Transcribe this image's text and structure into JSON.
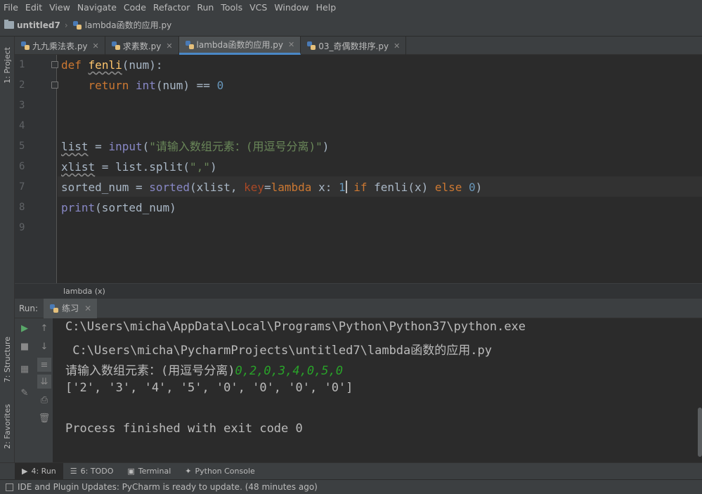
{
  "menu": [
    "File",
    "Edit",
    "View",
    "Navigate",
    "Code",
    "Refactor",
    "Run",
    "Tools",
    "VCS",
    "Window",
    "Help"
  ],
  "breadcrumb": {
    "project": "untitled7",
    "file": "lambda函数的应用.py"
  },
  "left_tools": {
    "project": "1: Project",
    "structure": "7: Structure",
    "favorites": "2: Favorites"
  },
  "tabs": [
    {
      "label": "九九乘法表.py",
      "active": false
    },
    {
      "label": "求素数.py",
      "active": false
    },
    {
      "label": "lambda函数的应用.py",
      "active": true
    },
    {
      "label": "03_奇偶数排序.py",
      "active": false
    }
  ],
  "line_numbers": [
    "1",
    "2",
    "3",
    "4",
    "5",
    "6",
    "7",
    "8",
    "9"
  ],
  "code": {
    "l1": {
      "def": "def",
      "name": "fenli",
      "rest": "(num):"
    },
    "l2": {
      "ret": "return",
      "int": "int",
      "rest": "(num) == ",
      "num": "0"
    },
    "l5": {
      "var": "list",
      "eq": " = ",
      "input": "input",
      "open": "(",
      "str": "\"请输入数组元素：(用逗号分离)\"",
      "close": ")"
    },
    "l6": {
      "var": "xlist",
      "rest1": " = list.split(",
      "str": "\",\"",
      "rest2": ")"
    },
    "l7": {
      "a": "sorted_num = ",
      "sorted": "sorted",
      "b": "(xlist, ",
      "key": "key",
      "c": "=",
      "lambda": "lambda",
      "d": " x: ",
      "one": "1",
      "if": "if",
      "e": " fenli(x) ",
      "else": "else",
      "zero": "0",
      "f": ")"
    },
    "l8": {
      "print": "print",
      "rest": "(sorted_num)"
    }
  },
  "hint": "lambda (x)",
  "run": {
    "label": "Run:",
    "config": "练习",
    "output": [
      "C:\\Users\\micha\\AppData\\Local\\Programs\\Python\\Python37\\python.exe",
      " C:\\Users\\micha\\PycharmProjects\\untitled7\\lambda函数的应用.py",
      "请输入数组元素：(用逗号分离)",
      "['2', '3', '4', '5', '0', '0', '0', '0']",
      "",
      "Process finished with exit code 0"
    ],
    "user_input": "0,2,0,3,4,0,5,0"
  },
  "bottom_tabs": [
    {
      "icon": "▶",
      "label": "4: Run"
    },
    {
      "icon": "☰",
      "label": "6: TODO"
    },
    {
      "icon": "▣",
      "label": "Terminal"
    },
    {
      "icon": "✦",
      "label": "Python Console"
    }
  ],
  "status": "IDE and Plugin Updates: PyCharm is ready to update. (48 minutes ago)"
}
